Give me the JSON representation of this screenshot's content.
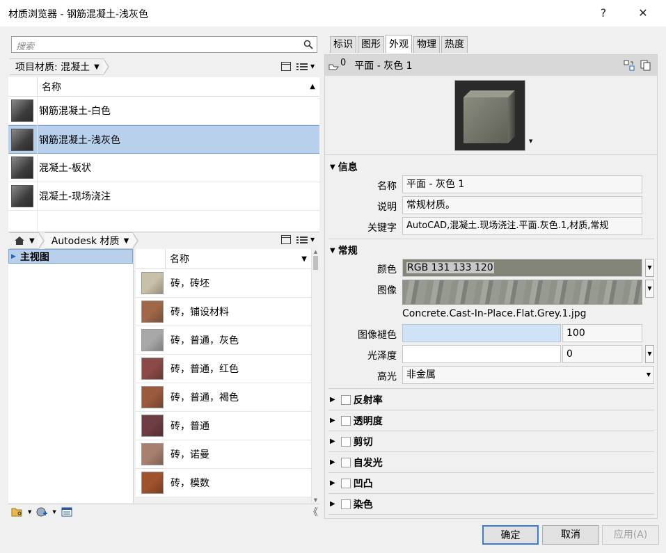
{
  "window": {
    "title": "材质浏览器 - 钢筋混凝土-浅灰色",
    "help": "?",
    "close": "✕"
  },
  "search": {
    "placeholder": "搜索"
  },
  "project": {
    "breadcrumb": "项目材质: 混凝土",
    "col_header": "名称",
    "items": [
      {
        "label": "钢筋混凝土-白色"
      },
      {
        "label": "钢筋混凝土-浅灰色"
      },
      {
        "label": "混凝土-板状"
      },
      {
        "label": "混凝土-现场浇注"
      }
    ]
  },
  "library": {
    "breadcrumb": "Autodesk 材质",
    "tree_root": "主视图",
    "col_header": "名称",
    "items": [
      {
        "label": "砖，砖坯",
        "color": "#c8c0a8"
      },
      {
        "label": "砖，铺设材料",
        "color": "#a06848"
      },
      {
        "label": "砖，普通，灰色",
        "color": "#a8a8a8"
      },
      {
        "label": "砖，普通，红色",
        "color": "#8c4a46"
      },
      {
        "label": "砖，普通，褐色",
        "color": "#9a5a3e"
      },
      {
        "label": "砖，普通",
        "color": "#6e3e44"
      },
      {
        "label": "砖，诺曼",
        "color": "#a88070"
      },
      {
        "label": "砖，模数",
        "color": "#a0522d"
      }
    ]
  },
  "tabs": [
    "标识",
    "图形",
    "外观",
    "物理",
    "热度"
  ],
  "asset": {
    "name": "平面 - 灰色 1",
    "hand_count": "0"
  },
  "info": {
    "section": "信息",
    "name_label": "名称",
    "name_value": "平面 - 灰色 1",
    "desc_label": "说明",
    "desc_value": "常规材质。",
    "kw_label": "关键字",
    "kw_value": "AutoCAD,混凝土.现场浇注.平面.灰色.1,材质,常规"
  },
  "general": {
    "section": "常规",
    "color_label": "颜色",
    "color_value": "RGB 131 133 120",
    "color_hex": "#838578",
    "image_label": "图像",
    "image_file": "Concrete.Cast-In-Place.Flat.Grey.1.jpg",
    "fade_label": "图像褪色",
    "fade_value": "100",
    "gloss_label": "光泽度",
    "gloss_value": "0",
    "highlight_label": "高光",
    "highlight_value": "非金属"
  },
  "collapsed": [
    {
      "label": "反射率"
    },
    {
      "label": "透明度"
    },
    {
      "label": "剪切"
    },
    {
      "label": "自发光"
    },
    {
      "label": "凹凸"
    },
    {
      "label": "染色"
    }
  ],
  "buttons": {
    "ok": "确定",
    "cancel": "取消",
    "apply": "应用(A)"
  }
}
